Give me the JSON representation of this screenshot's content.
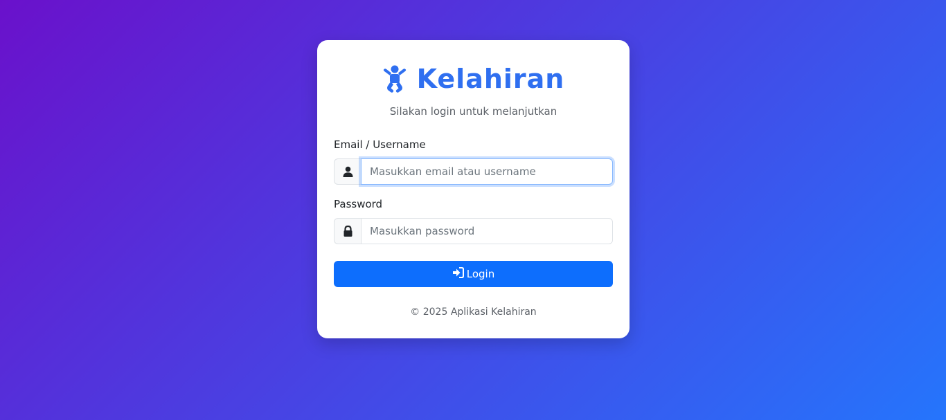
{
  "brand": {
    "title": "Kelahiran",
    "icon": "baby-icon",
    "color": "#2f6ff0"
  },
  "subtitle": "Silakan login untuk melanjutkan",
  "form": {
    "email": {
      "label": "Email / Username",
      "placeholder": "Masukkan email atau username",
      "value": "",
      "icon": "user-icon"
    },
    "password": {
      "label": "Password",
      "placeholder": "Masukkan password",
      "value": "",
      "icon": "lock-icon"
    },
    "submit": {
      "label": "Login",
      "icon": "sign-in-icon",
      "color": "#0d6efd"
    }
  },
  "footer": "© 2025 Aplikasi Kelahiran",
  "theme": {
    "gradient_start": "#6a11cb",
    "gradient_end": "#2575fc"
  }
}
